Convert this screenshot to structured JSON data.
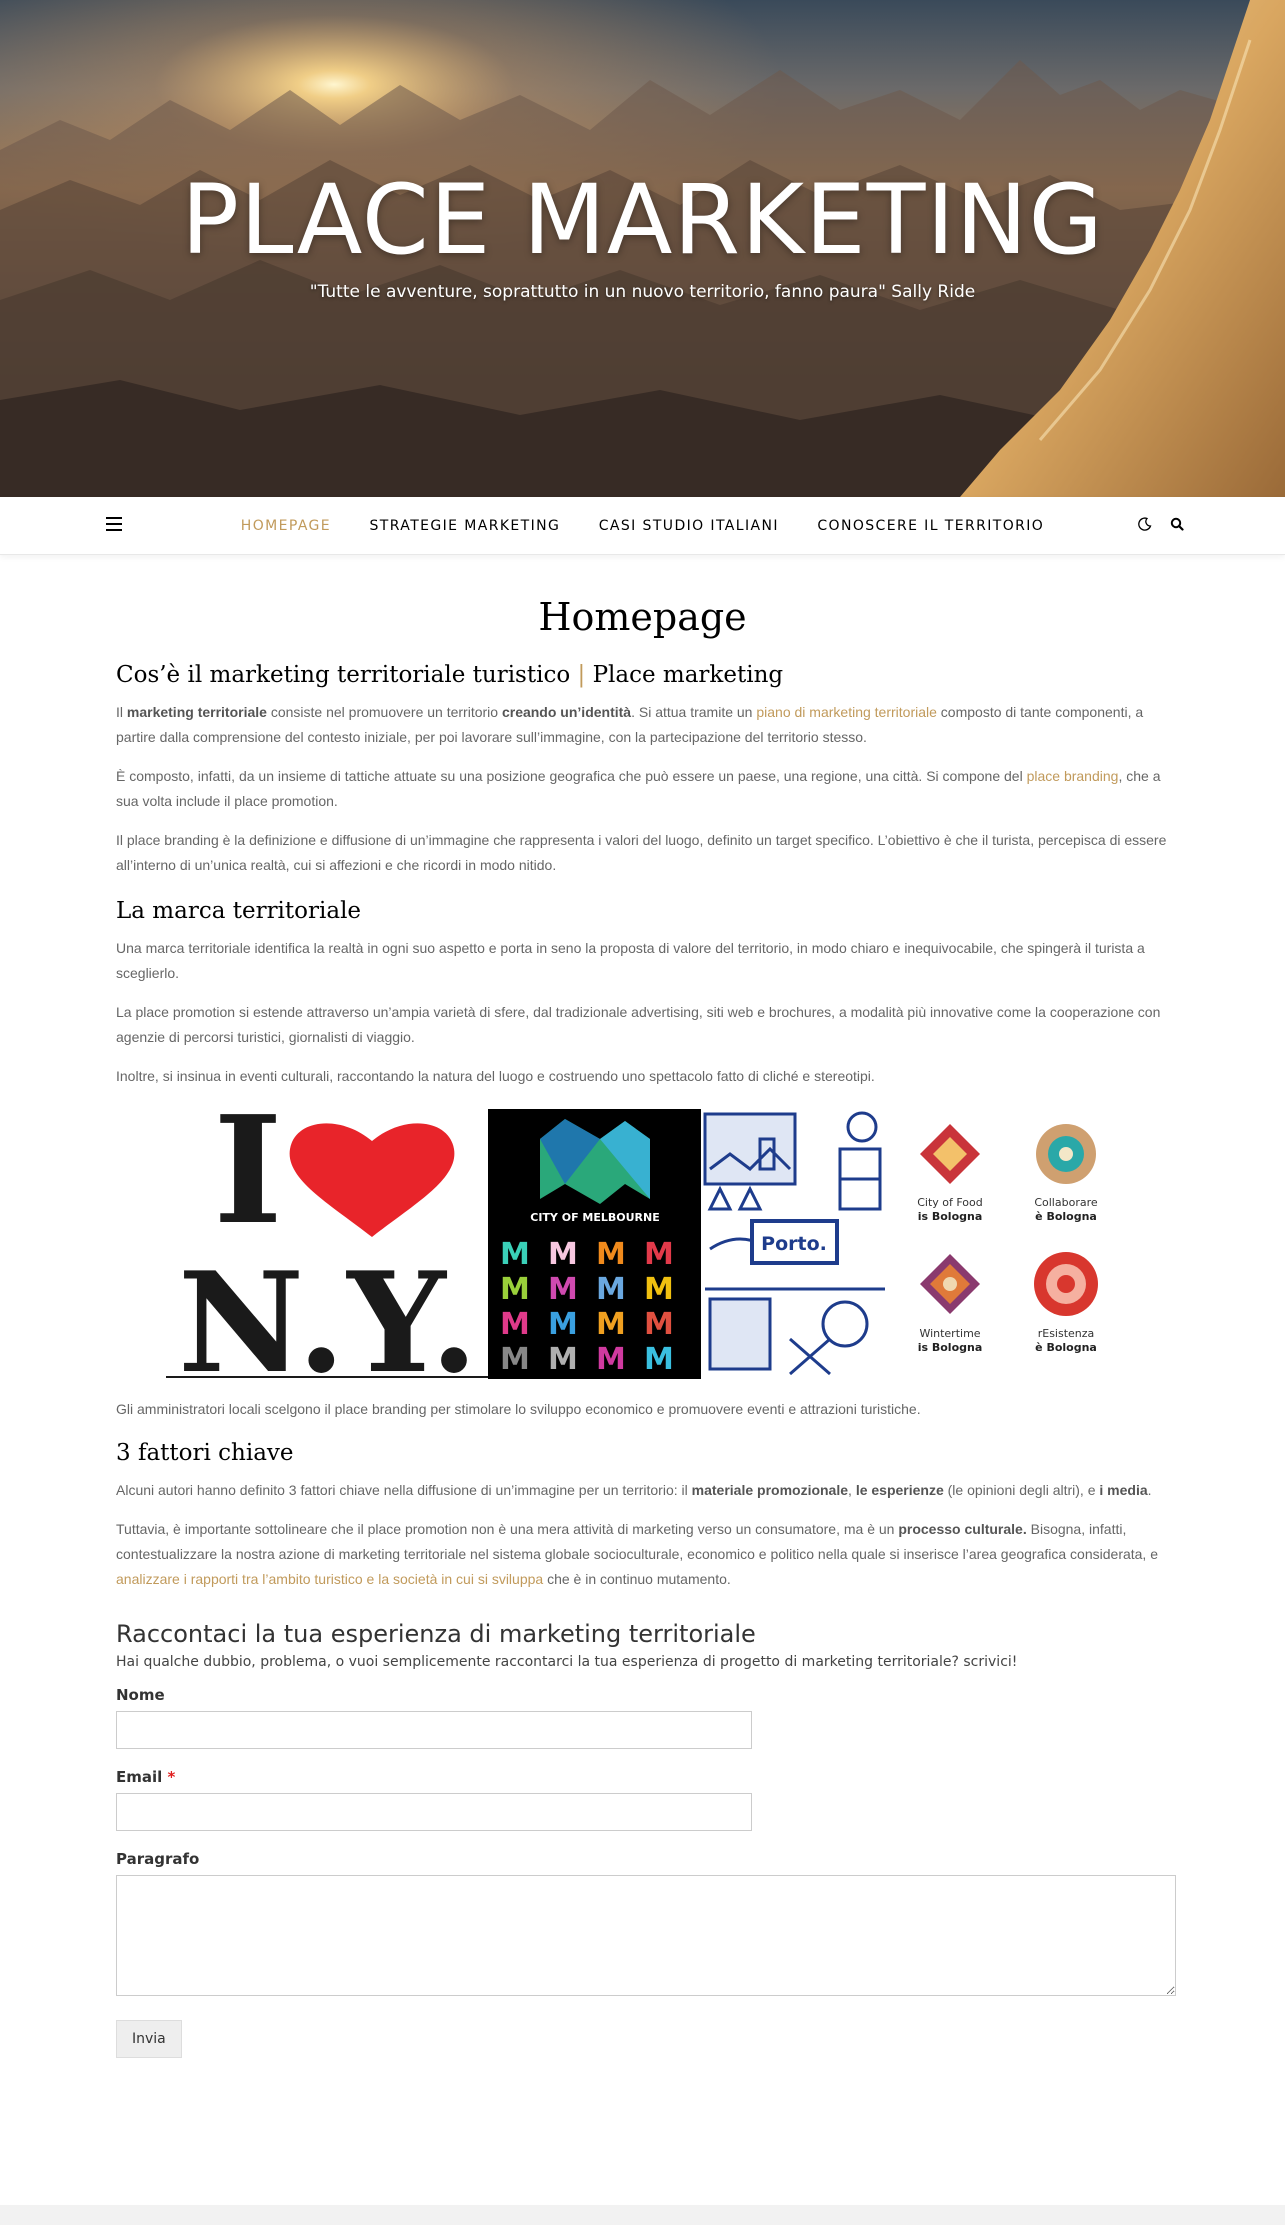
{
  "header": {
    "site_title": "PLACE MARKETING",
    "tagline": "\"Tutte le avventure, soprattutto in un nuovo territorio, fanno paura\" Sally Ride"
  },
  "nav": {
    "items": [
      {
        "label": "HOMEPAGE",
        "active": true
      },
      {
        "label": "STRATEGIE MARKETING",
        "active": false
      },
      {
        "label": "CASI STUDIO ITALIANI",
        "active": false
      },
      {
        "label": "CONOSCERE IL TERRITORIO",
        "active": false
      }
    ],
    "icons": [
      "menu-icon",
      "moon-icon",
      "search-icon"
    ],
    "accent_color": "#c19a5b"
  },
  "page": {
    "title": "Homepage",
    "section1": {
      "heading_part1": "Cos’è il marketing territoriale turistico",
      "heading_sep": "|",
      "heading_part2": "Place marketing",
      "p1": {
        "t1": "Il ",
        "b1": "marketing territoriale",
        "t2": " consiste nel promuovere un territorio ",
        "b2": "creando un’identità",
        "t3": ". Si attua tramite un ",
        "link": "piano di marketing territoriale",
        "t4": " composto di tante componenti, a partire dalla comprensione del contesto iniziale, per poi lavorare sull’immagine, con la partecipazione del territorio stesso."
      },
      "p2": {
        "t1": "È composto, infatti, da un insieme di tattiche attuate su una posizione geografica che può essere un paese, una regione, una città. Si compone del ",
        "link": "place branding",
        "t2": ", che a sua volta include il place promotion."
      },
      "p3": "Il place branding è la definizione e diffusione di un’immagine che rappresenta i valori del luogo, definito un target specifico. L’obiettivo è che il turista, percepisca di essere all’interno di un’unica realtà, cui si affezioni e che ricordi in modo nitido."
    },
    "section2": {
      "heading": "La marca territoriale",
      "p1": "Una marca territoriale identifica la realtà in ogni suo aspetto e porta in seno la proposta di valore del territorio, in modo chiaro e inequivocabile, che spingerà il turista a sceglierlo.",
      "p2": "La place promotion si estende attraverso un’ampia varietà di sfere, dal tradizionale advertising, siti web e brochures, a modalità più innovative come la cooperazione con agenzie di percorsi turistici, giornalisti di viaggio.",
      "p3": "Inoltre, si insinua in eventi culturali, raccontando la natura del luogo e costruendo uno spettacolo fatto di cliché e stereotipi."
    },
    "collage": {
      "ny_top": "I",
      "ny_bottom": "N.Y.",
      "melbourne": "CITY OF MELBOURNE",
      "porto": "Porto.",
      "bologna": [
        {
          "line1": "City of Food",
          "line2": "is Bologna",
          "color": "#c9343a"
        },
        {
          "line1": "Collaborare",
          "line2": "è Bologna",
          "color": "#2aa8a8"
        },
        {
          "line1": "Wintertime",
          "line2": "is Bologna",
          "color": "#8a3a6e"
        },
        {
          "line1": "rEsistenza",
          "line2": "è Bologna",
          "color": "#d8372e"
        }
      ]
    },
    "caption": "Gli amministratori locali scelgono il place branding per stimolare lo sviluppo economico e promuovere eventi e attrazioni turistiche.",
    "section3": {
      "heading": "3 fattori chiave",
      "p1": {
        "t1": "Alcuni autori hanno definito 3 fattori chiave nella diffusione di un’immagine per un territorio: il ",
        "b1": "materiale promozionale",
        "t2": ", ",
        "b2": "le esperienze",
        "t3": " (le opinioni degli altri), e ",
        "b3": "i media",
        "t4": "."
      },
      "p2": {
        "t1": "Tuttavia, è importante sottolineare che il place promotion non è una mera attività di marketing verso un consumatore, ma è un ",
        "b1": "processo culturale.",
        "t2": " Bisogna, infatti, contestualizzare la nostra azione di marketing territoriale nel sistema globale socioculturale, economico e politico nella quale si inserisce l’area geografica considerata, e ",
        "link": "analizzare i rapporti tra l’ambito turistico e la società in cui si sviluppa",
        "t3": " che è in continuo mutamento."
      }
    }
  },
  "form": {
    "title": "Raccontaci la tua esperienza di marketing territoriale",
    "intro": "Hai qualche dubbio, problema, o vuoi semplicemente raccontarci la tua esperienza di progetto di marketing territoriale? scrivici!",
    "name_label": "Nome",
    "email_label": "Email",
    "required_mark": "*",
    "paragraph_label": "Paragrafo",
    "submit_label": "Invia"
  }
}
